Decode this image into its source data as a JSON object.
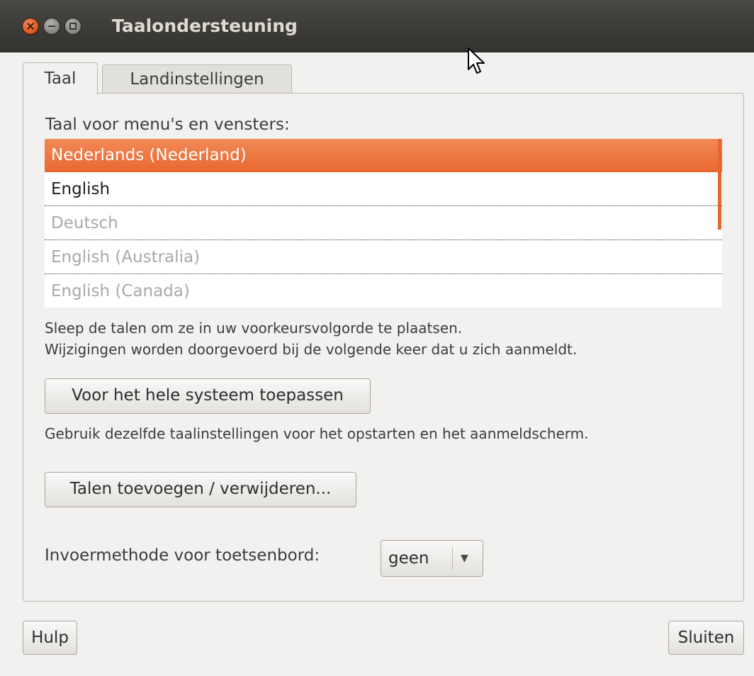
{
  "window": {
    "title": "Taalondersteuning"
  },
  "tabs": [
    {
      "label": "Taal",
      "active": true
    },
    {
      "label": "Landinstellingen",
      "active": false
    }
  ],
  "language_section": {
    "label": "Taal voor menu's en vensters:",
    "items": [
      {
        "label": "Nederlands (Nederland)",
        "state": "selected"
      },
      {
        "label": "English",
        "state": "enabled"
      },
      {
        "label": "Deutsch",
        "state": "disabled"
      },
      {
        "label": "English (Australia)",
        "state": "disabled"
      },
      {
        "label": "English (Canada)",
        "state": "disabled"
      }
    ],
    "hint_line1": "Sleep de talen om ze in uw voorkeursvolgorde te plaatsen.",
    "hint_line2": "Wijzigingen worden doorgevoerd bij de volgende keer dat u zich aanmeldt."
  },
  "apply_system": {
    "button_label": "Voor het hele systeem toepassen",
    "description": "Gebruik dezelfde taalinstellingen voor het opstarten en het aanmeldscherm."
  },
  "add_remove": {
    "button_label": "Talen toevoegen / verwijderen..."
  },
  "keyboard_input": {
    "label": "Invoermethode voor toetsenbord:",
    "selected_value": "geen"
  },
  "footer": {
    "help_label": "Hulp",
    "close_label": "Sluiten"
  },
  "colors": {
    "accent": "#e9672f",
    "titlebar": "#3c3b37"
  },
  "icons": {
    "close": "close-icon",
    "minimize": "minimize-icon",
    "maximize": "maximize-icon",
    "dropdown": "chevron-down-icon",
    "pointer": "mouse-pointer-icon"
  }
}
